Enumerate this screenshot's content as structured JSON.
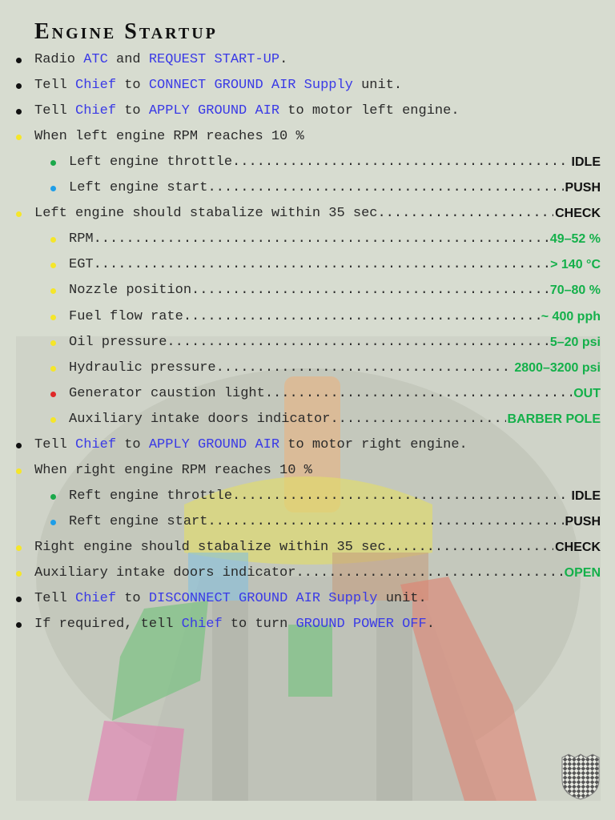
{
  "title": "Engine Startup",
  "colors": {
    "black": "#111111",
    "yellow": "#f5e62a",
    "green": "#1aa84a",
    "blue": "#1e9ee8",
    "red": "#e02828",
    "value_green": "#14b04a",
    "link_blue": "#3a3ae6"
  },
  "steps": [
    {
      "bullet": "black",
      "parts": [
        {
          "t": "Radio "
        },
        {
          "t": "ATC",
          "hl": true
        },
        {
          "t": " and "
        },
        {
          "t": "REQUEST START-UP",
          "hl": true
        },
        {
          "t": "."
        }
      ]
    },
    {
      "bullet": "black",
      "parts": [
        {
          "t": "Tell "
        },
        {
          "t": "Chief",
          "hl": true
        },
        {
          "t": " to "
        },
        {
          "t": "CONNECT GROUND AIR Supply",
          "hl": true
        },
        {
          "t": " unit."
        }
      ]
    },
    {
      "bullet": "black",
      "parts": [
        {
          "t": "Tell "
        },
        {
          "t": "Chief",
          "hl": true
        },
        {
          "t": " to "
        },
        {
          "t": "APPLY GROUND AIR",
          "hl": true
        },
        {
          "t": " to motor left engine."
        }
      ]
    },
    {
      "bullet": "yellow",
      "parts": [
        {
          "t": "When left engine RPM reaches 10 %"
        }
      ]
    },
    {
      "bullet": "green",
      "level": 1,
      "label": "Left engine throttle",
      "value": "IDLE",
      "value_color": "black"
    },
    {
      "bullet": "blue",
      "level": 1,
      "label": "Left engine start",
      "value": "PUSH",
      "value_color": "black"
    },
    {
      "bullet": "yellow",
      "label": "Left engine should stabalize within 35 sec",
      "value": "CHECK",
      "value_color": "black"
    },
    {
      "bullet": "yellow",
      "level": 1,
      "label": "RPM",
      "value": "49–52 %",
      "value_color": "green"
    },
    {
      "bullet": "yellow",
      "level": 1,
      "label": "EGT",
      "value": "> 140 °C",
      "value_color": "green"
    },
    {
      "bullet": "yellow",
      "level": 1,
      "label": "Nozzle position",
      "value": "70–80 %",
      "value_color": "green"
    },
    {
      "bullet": "yellow",
      "level": 1,
      "label": "Fuel flow rate",
      "value": "~ 400 pph",
      "value_color": "green"
    },
    {
      "bullet": "yellow",
      "level": 1,
      "label": "Oil pressure",
      "value": "5–20 psi",
      "value_color": "green"
    },
    {
      "bullet": "yellow",
      "level": 1,
      "label": "Hydraulic pressure",
      "value": "2800–3200 psi",
      "value_color": "green"
    },
    {
      "bullet": "red",
      "level": 1,
      "label": "Generator caustion light",
      "value": "OUT",
      "value_color": "green"
    },
    {
      "bullet": "yellow",
      "level": 1,
      "label": "Auxiliary intake doors indicator",
      "value": "BARBER POLE",
      "value_color": "green"
    },
    {
      "bullet": "black",
      "parts": [
        {
          "t": "Tell "
        },
        {
          "t": "Chief",
          "hl": true
        },
        {
          "t": " to "
        },
        {
          "t": "APPLY GROUND AIR",
          "hl": true
        },
        {
          "t": " to motor right engine."
        }
      ]
    },
    {
      "bullet": "yellow",
      "parts": [
        {
          "t": "When right engine RPM reaches 10 %"
        }
      ]
    },
    {
      "bullet": "green",
      "level": 1,
      "label": "Reft engine throttle",
      "value": "IDLE",
      "value_color": "black"
    },
    {
      "bullet": "blue",
      "level": 1,
      "label": "Reft engine start",
      "value": "PUSH",
      "value_color": "black"
    },
    {
      "bullet": "yellow",
      "label": "Right engine should stabalize within 35 sec",
      "value": "CHECK",
      "value_color": "black"
    },
    {
      "bullet": "yellow",
      "label": "Auxiliary intake doors indicator",
      "value": "OPEN",
      "value_color": "green"
    },
    {
      "bullet": "black",
      "parts": [
        {
          "t": "Tell "
        },
        {
          "t": "Chief",
          "hl": true
        },
        {
          "t": " to "
        },
        {
          "t": "DISCONNECT GROUND AIR Supply",
          "hl": true
        },
        {
          "t": " unit."
        }
      ]
    },
    {
      "bullet": "black",
      "parts": [
        {
          "t": "If required, tell "
        },
        {
          "t": "Chief",
          "hl": true
        },
        {
          "t": " to turn "
        },
        {
          "t": "GROUND POWER OFF",
          "hl": true
        },
        {
          "t": "."
        }
      ]
    }
  ]
}
